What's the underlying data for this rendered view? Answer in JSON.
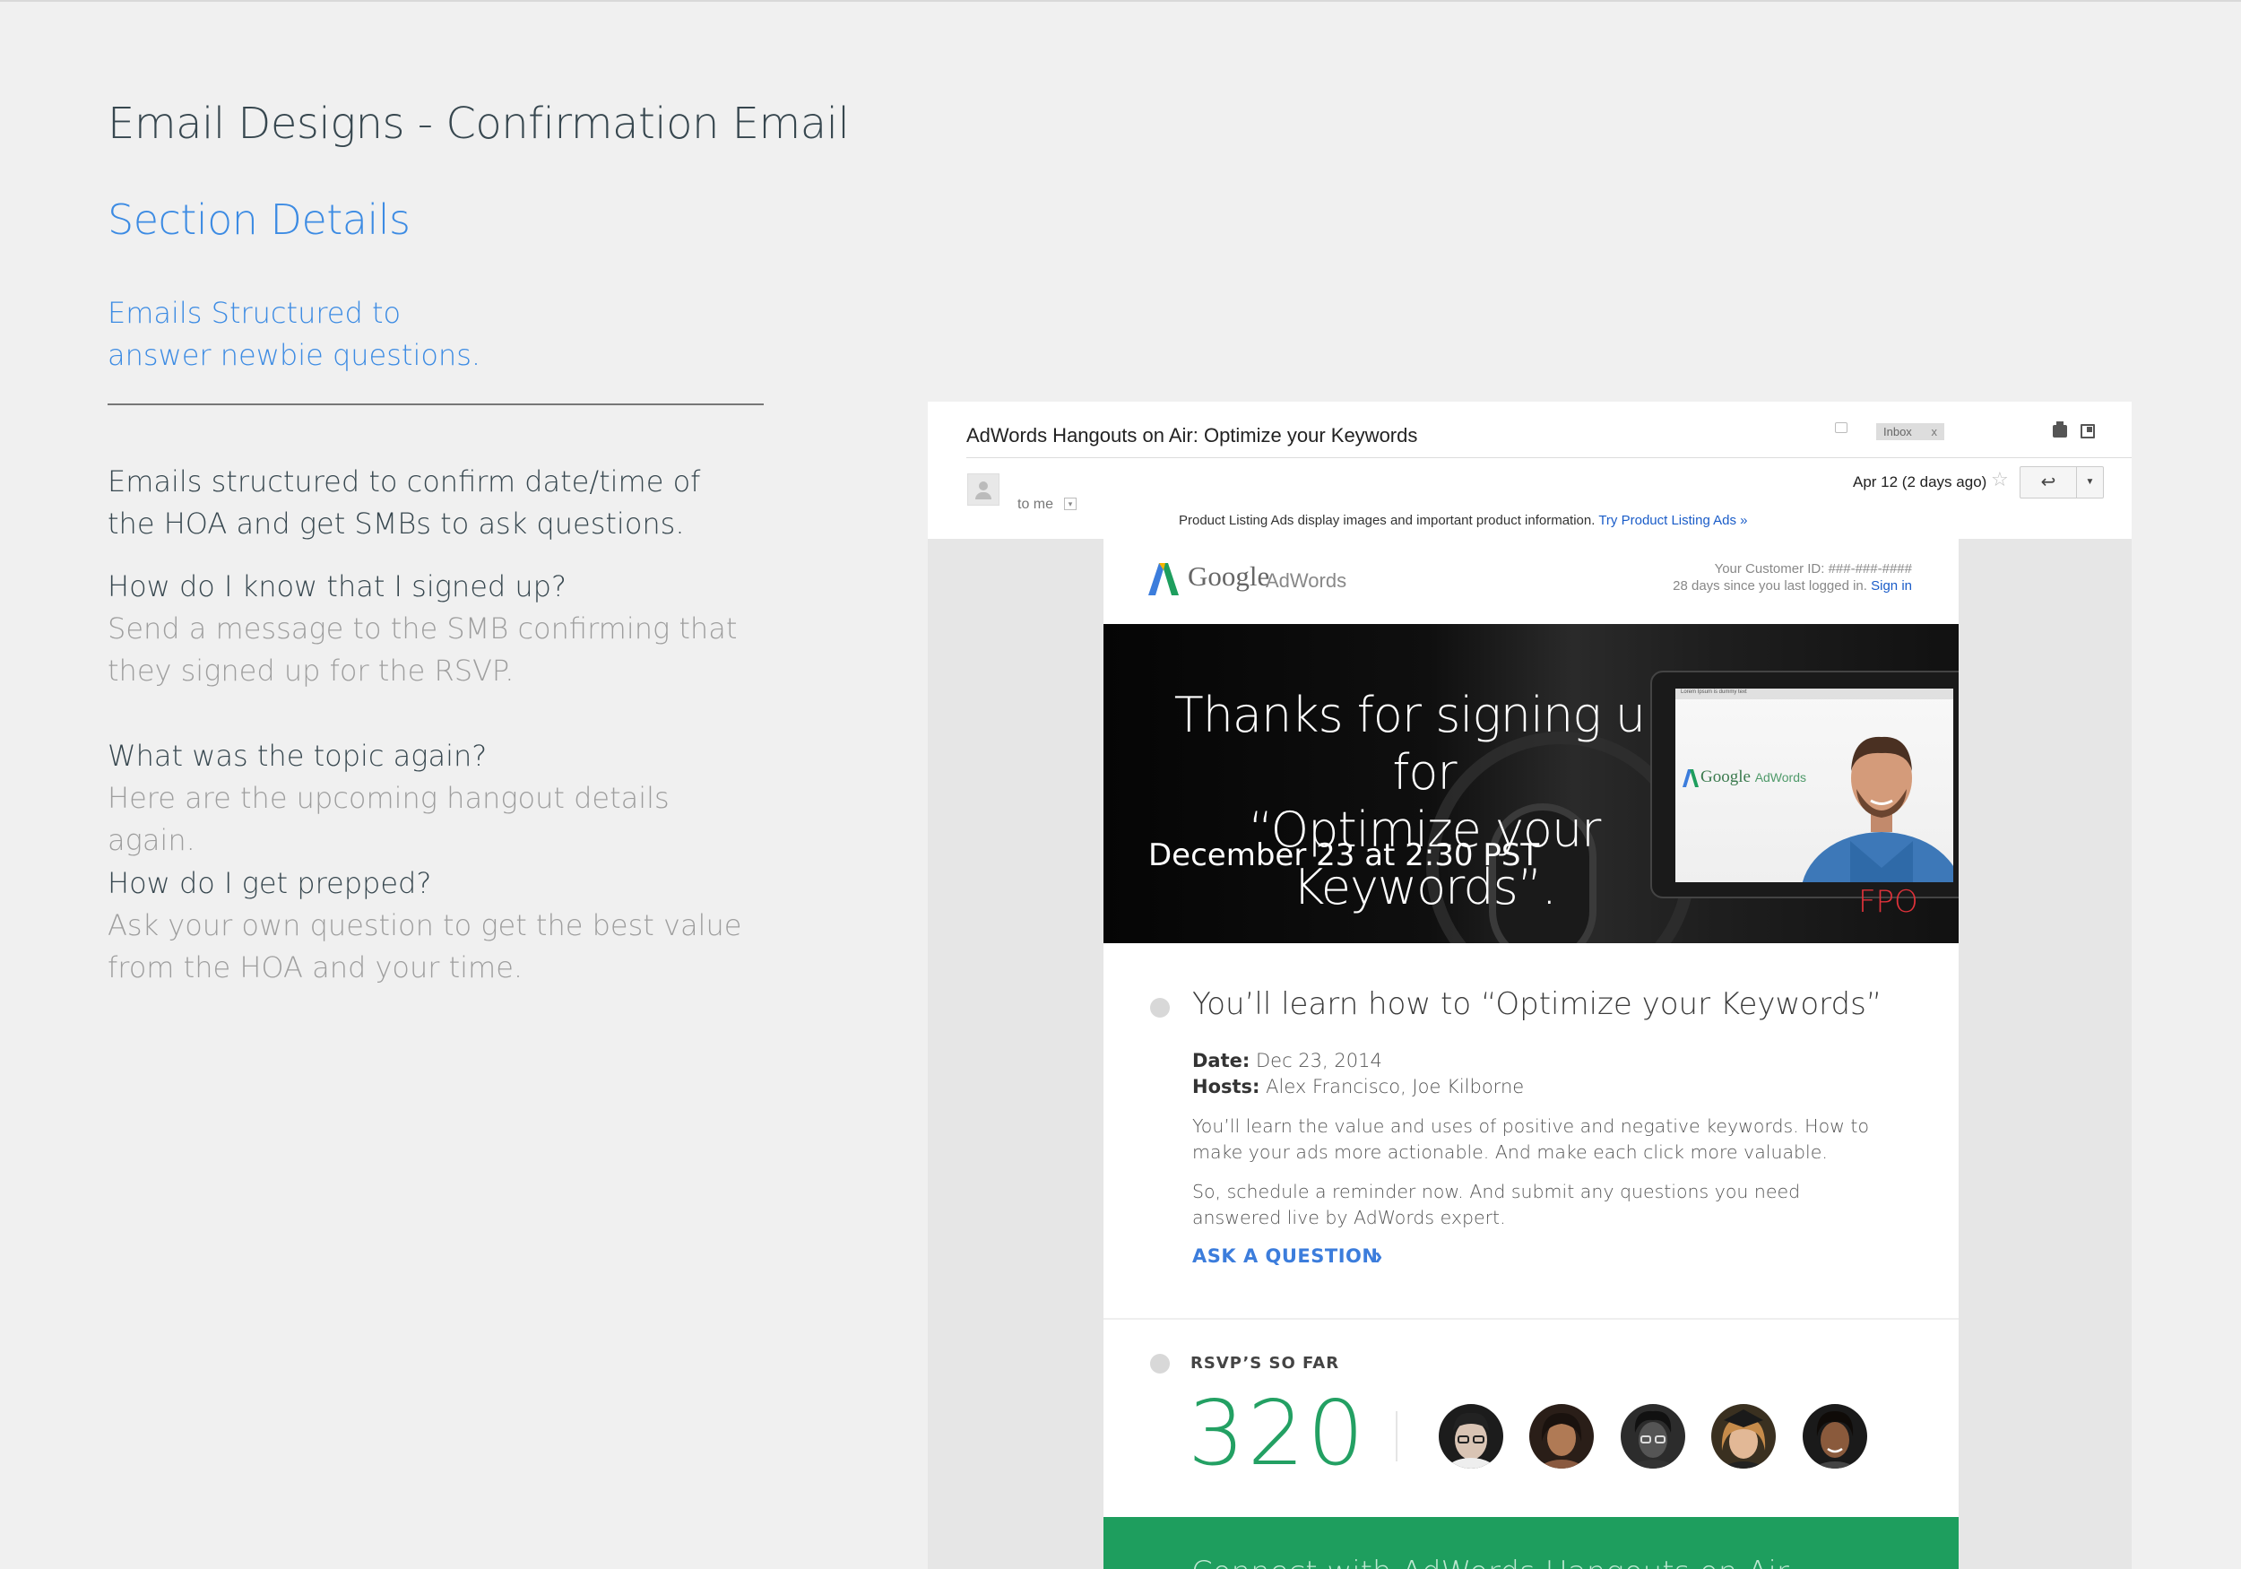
{
  "page": {
    "title": "Email Designs - Confirmation Email",
    "section_title": "Section Details",
    "section_subtitle": "Emails Structured to answer newbie questions.",
    "intro": "Emails structured to confirm date/time of the HOA and get SMBs to ask questions.",
    "qa": [
      {
        "question": "How do I know that I signed up?",
        "answer": "Send a message to the SMB confirming that they signed up for the RSVP."
      },
      {
        "question": "What was the topic again?",
        "answer": "Here are the upcoming hangout details again."
      },
      {
        "question": "How do I get prepped?",
        "answer": "Ask your own question to get the best value from the HOA and your time."
      }
    ]
  },
  "client": {
    "subject": "AdWords Hangouts on Air: Optimize your Keywords",
    "inbox_label": "Inbox",
    "inbox_close": "x",
    "to_me": "to me",
    "date": "Apr 12 (2 days ago)",
    "star_glyph": "☆",
    "reply_glyph": "↩",
    "more_glyph": "▼",
    "pla_text": "Product Listing Ads display images and important product information.",
    "pla_link": "Try Product Listing Ads »"
  },
  "email": {
    "logo_google": "Google",
    "logo_adwords": "AdWords",
    "customer_id": "Your Customer ID: ###-###-####",
    "last_login": "28 days since you last logged in.",
    "sign_in": "Sign in",
    "hero": {
      "title_line1": "Thanks for signing up for",
      "title_line2": "“Optimize your Keywords”.",
      "date": "December 23 at 2:30 PST",
      "tablet_bar_text": "Lorem Ipsum is dummy text",
      "tablet_google": "Google",
      "tablet_adwords": "AdWords",
      "fpo": "FPO"
    },
    "learn": {
      "title": "You’ll learn how to “Optimize your Keywords”",
      "date_label": "Date:",
      "date_value": "Dec 23, 2014",
      "hosts_label": "Hosts:",
      "hosts_value": "Alex Francisco, Joe Kilborne",
      "para1": "You’ll learn the value and uses of positive and negative keywords. How to make your ads more actionable. And make each click more valuable.",
      "para2": "So, schedule a reminder now. And submit any questions you need answered live by AdWords expert.",
      "cta": "ASK A QUESTION",
      "cta_chevron": "›"
    },
    "rsvp": {
      "label": "RSVP’S SO FAR",
      "count": "320"
    },
    "footer_text": "Connect with AdWords Hangouts on Air"
  },
  "colors": {
    "accent_blue": "#3c8be3",
    "rsvp_green": "#23a063",
    "footer_green": "#1e9e5e",
    "fpo_red": "#e0323a"
  }
}
